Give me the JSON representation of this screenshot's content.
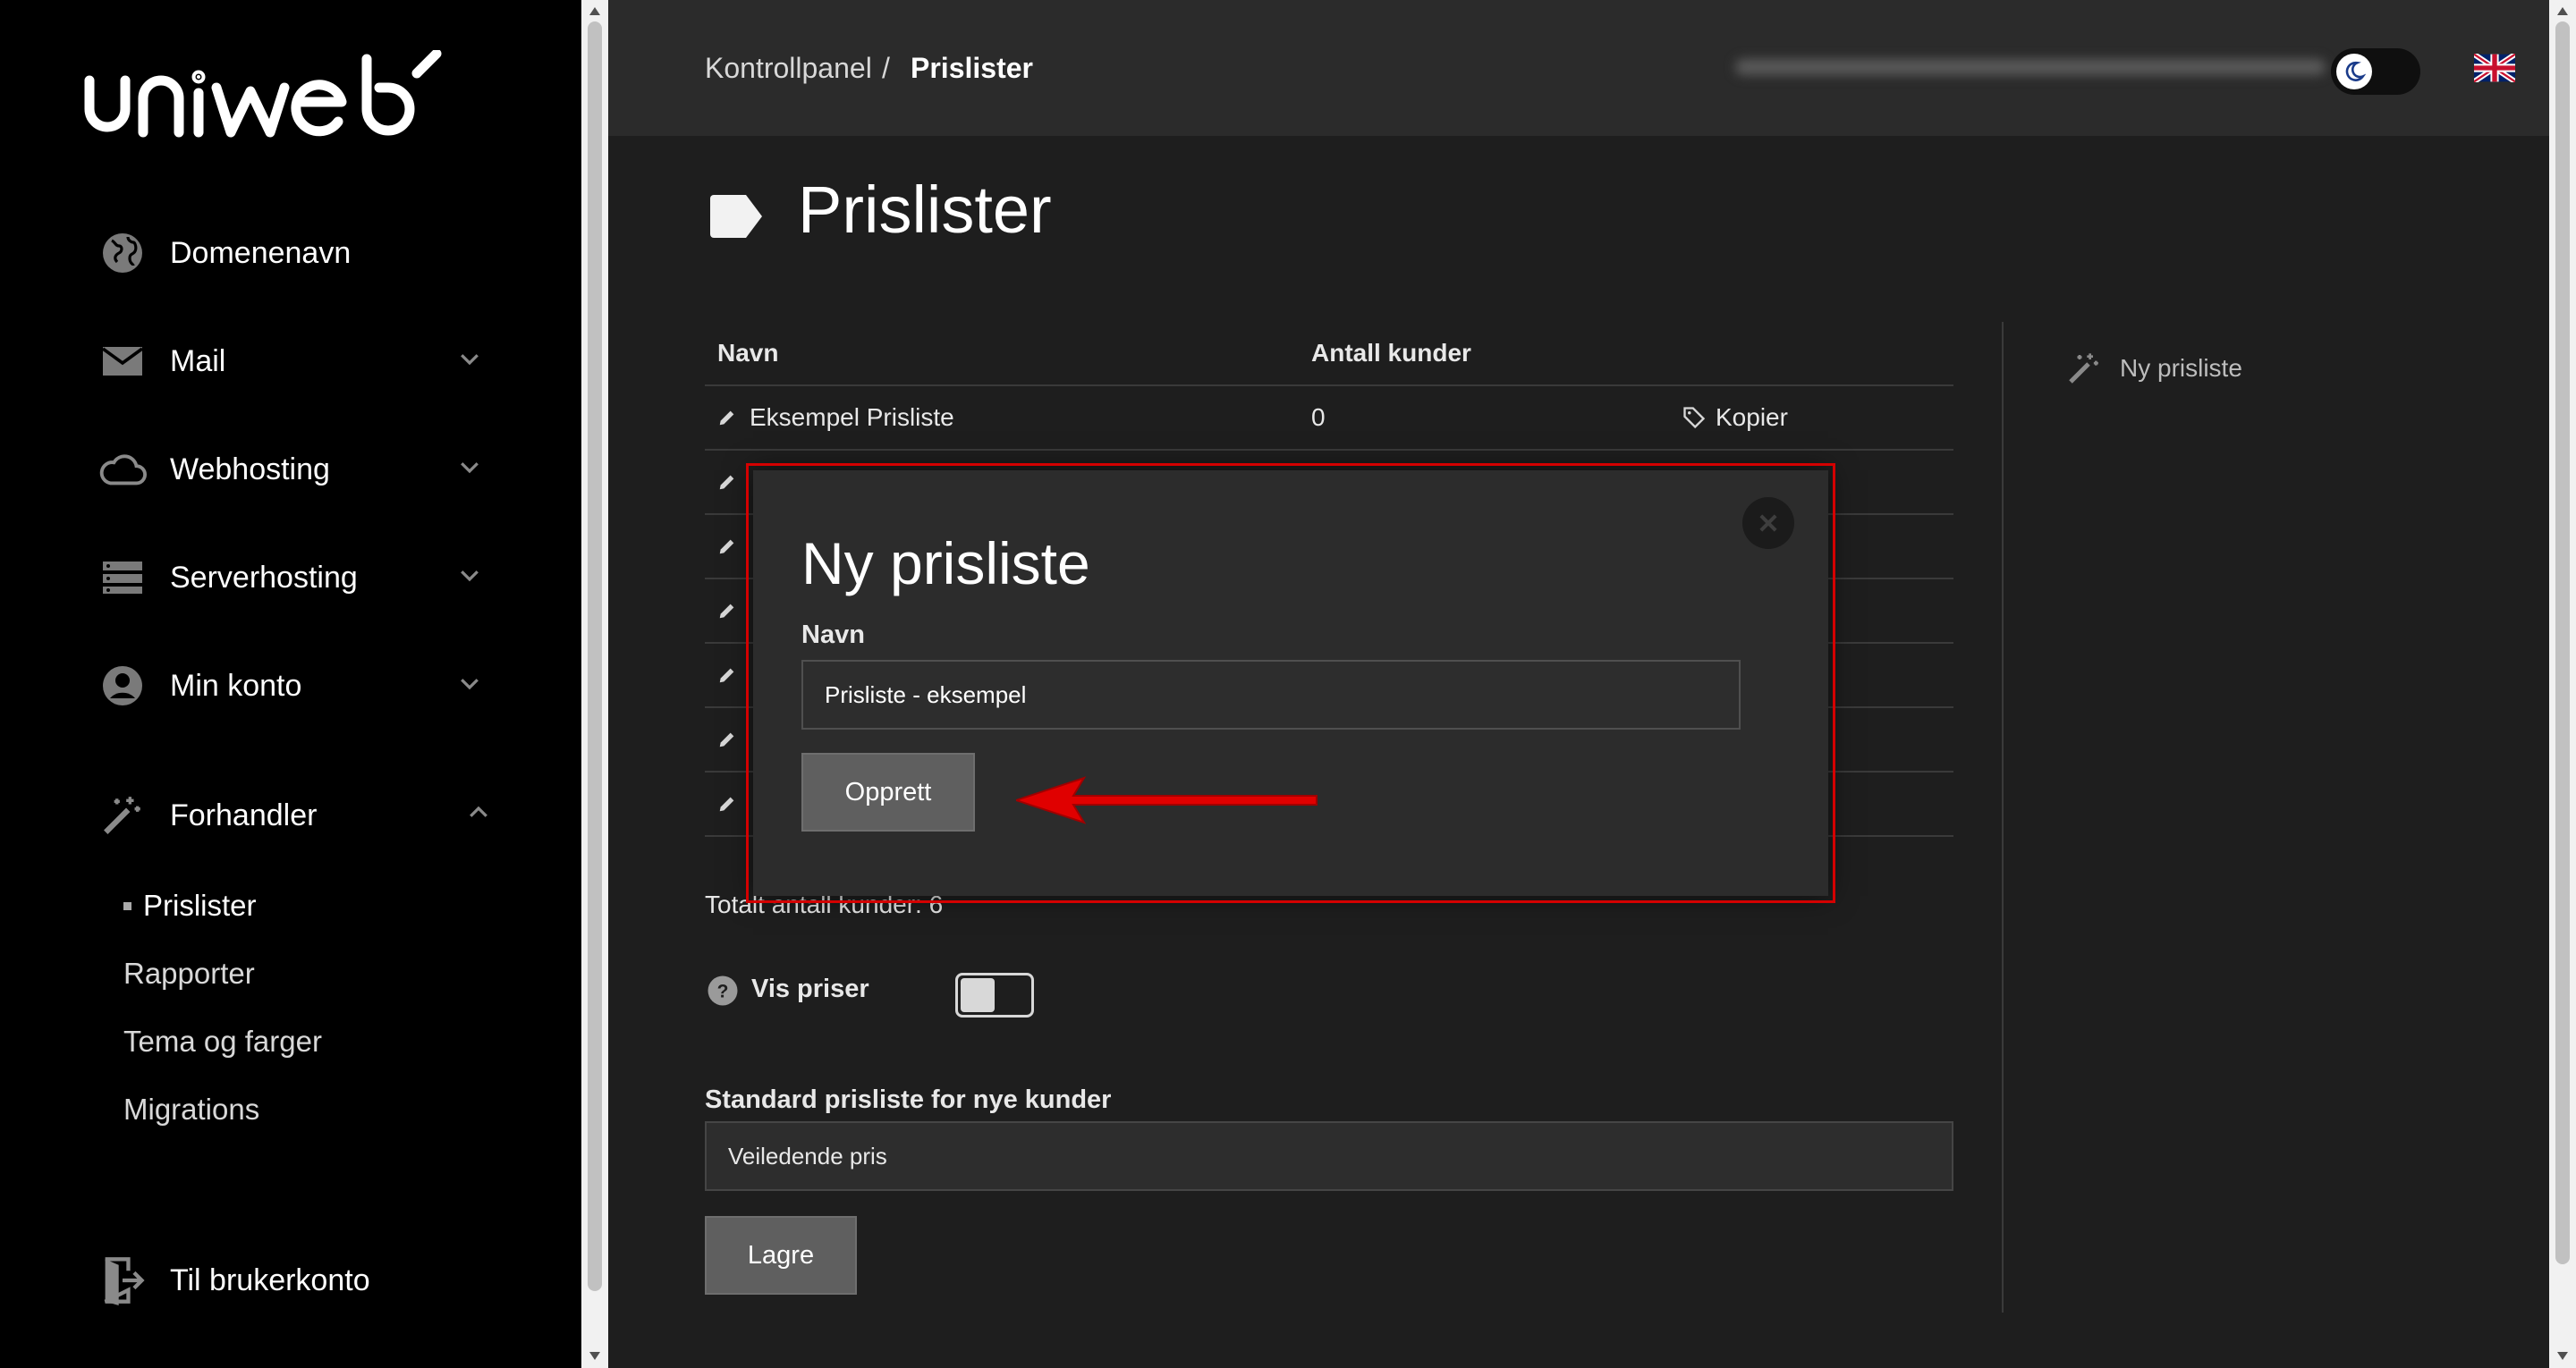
{
  "brand": {
    "logo_text": "uniweb"
  },
  "sidebar": {
    "items": [
      {
        "label": "Domenenavn",
        "icon": "globe-icon"
      },
      {
        "label": "Mail",
        "icon": "mail-icon",
        "chevron": "down"
      },
      {
        "label": "Webhosting",
        "icon": "cloud-icon",
        "chevron": "down"
      },
      {
        "label": "Serverhosting",
        "icon": "server-icon",
        "chevron": "down"
      },
      {
        "label": "Min konto",
        "icon": "account-icon",
        "chevron": "down"
      },
      {
        "label": "Forhandler",
        "icon": "magic-wand-icon",
        "chevron": "up"
      }
    ],
    "subitems": [
      "Prislister",
      "Rapporter",
      "Tema og farger",
      "Migrations"
    ],
    "active_subitem": "Prislister",
    "footer_link": "Til brukerkonto"
  },
  "header": {
    "breadcrumb_root": "Kontrollpanel",
    "breadcrumb_sep": "/",
    "breadcrumb_current": "Prislister",
    "language_flag": "uk-flag-icon",
    "theme_icon": "moon-icon"
  },
  "page": {
    "title": "Prislister",
    "table": {
      "columns": [
        "Navn",
        "Antall kunder"
      ],
      "first_row": {
        "name": "Eksempel Prisliste",
        "count": "0",
        "action": "Kopier"
      }
    },
    "total": "Totalt antall kunder: 6",
    "vis_priser_label": "Vis priser",
    "standard_label": "Standard prisliste for nye kunder",
    "standard_value": "Veiledende pris",
    "save_label": "Lagre",
    "side_action": "Ny prisliste"
  },
  "modal": {
    "title": "Ny prisliste",
    "name_label": "Navn",
    "name_value": "Prisliste - eksempel",
    "submit_label": "Opprett"
  },
  "colors": {
    "sidebar_bg": "#000000",
    "main_bg": "#1e1e1e",
    "header_bg": "#2b2b2b",
    "modal_bg": "#2c2c2c",
    "annotation_red": "#e00000",
    "button_bg": "#5f5f5f"
  }
}
